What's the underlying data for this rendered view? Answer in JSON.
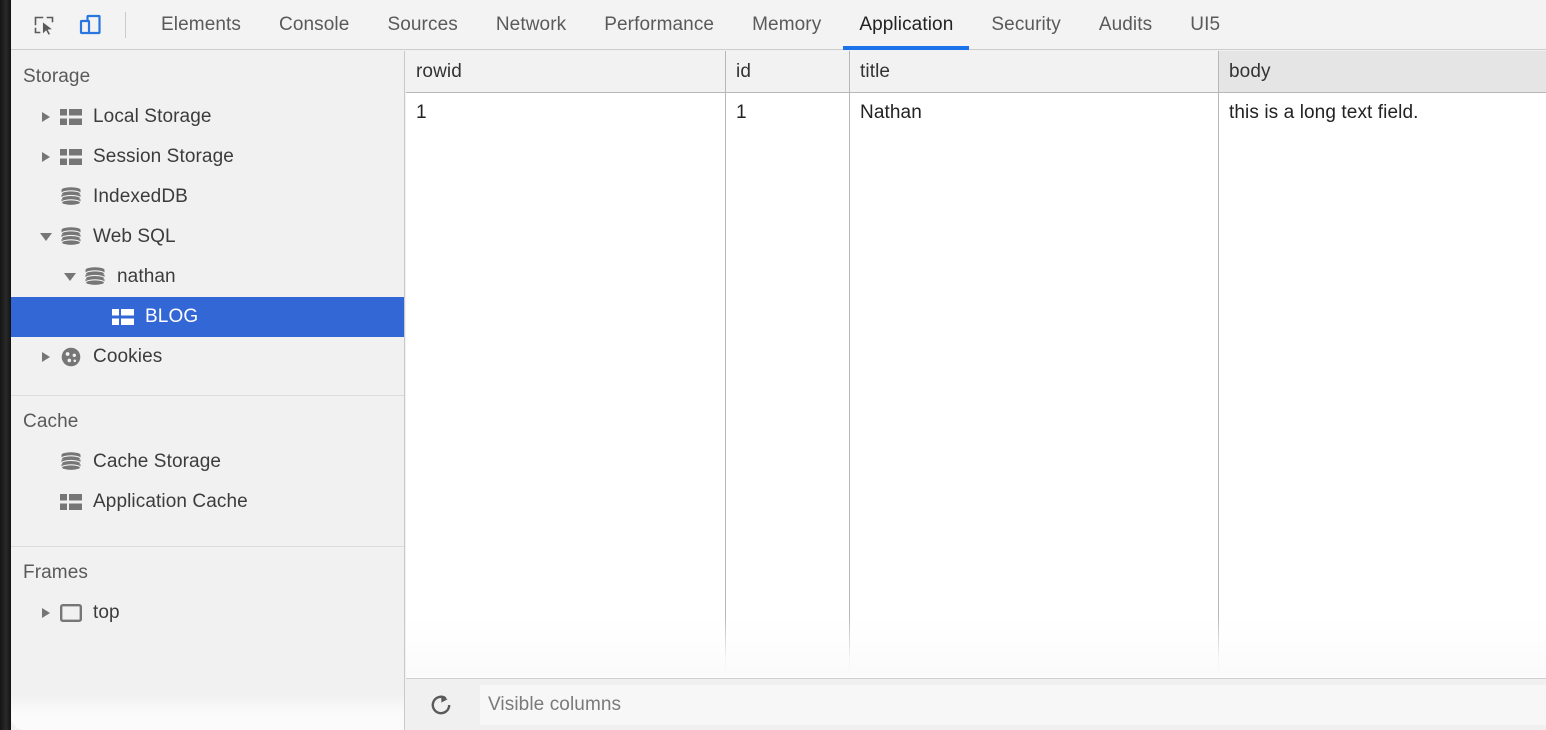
{
  "toolbar": {
    "inspect_icon": "inspect-element-icon",
    "device_icon": "device-toolbar-icon",
    "tabs": [
      {
        "label": "Elements",
        "active": false
      },
      {
        "label": "Console",
        "active": false
      },
      {
        "label": "Sources",
        "active": false
      },
      {
        "label": "Network",
        "active": false
      },
      {
        "label": "Performance",
        "active": false
      },
      {
        "label": "Memory",
        "active": false
      },
      {
        "label": "Application",
        "active": true
      },
      {
        "label": "Security",
        "active": false
      },
      {
        "label": "Audits",
        "active": false
      },
      {
        "label": "UI5",
        "active": false
      }
    ],
    "accent_color": "#1a73e8"
  },
  "sidebar": {
    "sections": [
      {
        "title": "Storage",
        "items": [
          {
            "label": "Local Storage",
            "icon": "table-icon",
            "arrow": "collapsed",
            "indent": 0,
            "selected": false
          },
          {
            "label": "Session Storage",
            "icon": "table-icon",
            "arrow": "collapsed",
            "indent": 0,
            "selected": false
          },
          {
            "label": "IndexedDB",
            "icon": "database-icon",
            "arrow": "none",
            "indent": 0,
            "selected": false
          },
          {
            "label": "Web SQL",
            "icon": "database-icon",
            "arrow": "expanded",
            "indent": 0,
            "selected": false
          },
          {
            "label": "nathan",
            "icon": "database-icon",
            "arrow": "expanded",
            "indent": 1,
            "selected": false
          },
          {
            "label": "BLOG",
            "icon": "table-icon",
            "arrow": "none",
            "indent": 2,
            "selected": true
          },
          {
            "label": "Cookies",
            "icon": "cookie-icon",
            "arrow": "collapsed",
            "indent": 0,
            "selected": false
          }
        ]
      },
      {
        "title": "Cache",
        "items": [
          {
            "label": "Cache Storage",
            "icon": "database-icon",
            "arrow": "none",
            "indent": 0,
            "selected": false
          },
          {
            "label": "Application Cache",
            "icon": "table-icon",
            "arrow": "none",
            "indent": 0,
            "selected": false
          }
        ]
      },
      {
        "title": "Frames",
        "items": [
          {
            "label": "top",
            "icon": "frame-icon",
            "arrow": "collapsed",
            "indent": 0,
            "selected": false
          }
        ]
      }
    ],
    "selected_color": "#3367d6"
  },
  "grid": {
    "columns": [
      {
        "key": "rowid",
        "label": "rowid",
        "sorted": false
      },
      {
        "key": "id",
        "label": "id",
        "sorted": false
      },
      {
        "key": "title",
        "label": "title",
        "sorted": false
      },
      {
        "key": "body",
        "label": "body",
        "sorted": true
      }
    ],
    "rows": [
      {
        "rowid": "1",
        "id": "1",
        "title": "Nathan",
        "body": "this is a long text field."
      }
    ]
  },
  "bottombar": {
    "refresh_icon": "refresh-icon",
    "filter_placeholder": "Visible columns",
    "filter_value": ""
  }
}
